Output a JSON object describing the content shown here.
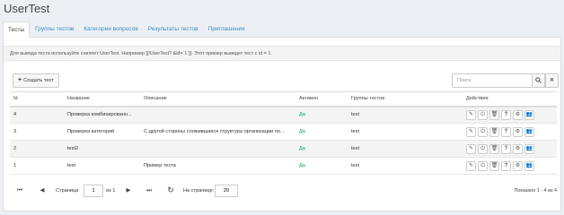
{
  "app": {
    "title": "UserTest"
  },
  "tabs": [
    {
      "label": "Тесты"
    },
    {
      "label": "Группы тестов"
    },
    {
      "label": "Категории вопросов"
    },
    {
      "label": "Результаты тестов"
    },
    {
      "label": "Приглашения"
    }
  ],
  "hint": "Для вывода теста используйте сниппет UserTest. Например [[!UserTest? &id=`1`]]. Этот пример выведет тест с id = 1.",
  "toolbar": {
    "create_label": "Создать тест",
    "create_icon": "plus-icon",
    "search_placeholder": "Поиск"
  },
  "table": {
    "headers": {
      "id": "Id",
      "name": "Название",
      "description": "Описание",
      "active": "Активно",
      "groups": "Группы тестов",
      "actions": "Действия"
    },
    "rows": [
      {
        "id": "4",
        "name": "Проверка комбинированн...",
        "description": "",
        "active": "Да",
        "groups": "test"
      },
      {
        "id": "3",
        "name": "Проверка категорий",
        "description": "С другой стороны сложившаяся структура организации по...",
        "active": "Да",
        "groups": "test"
      },
      {
        "id": "2",
        "name": "test2",
        "description": "",
        "active": "Да",
        "groups": "test"
      },
      {
        "id": "1",
        "name": "test",
        "description": "Пример теста",
        "active": "Да",
        "groups": "test"
      }
    ],
    "action_icons": [
      "edit-icon",
      "power-icon",
      "trash-icon",
      "question-icon",
      "settings-icon",
      "users-icon"
    ]
  },
  "pager": {
    "page_label": "Страница",
    "page_value": "1",
    "of_label": "из 1",
    "per_page_label": "На странице:",
    "per_page_value": "20",
    "summary": "Показано 1 - 4 из 4"
  },
  "colors": {
    "link": "#3c8dbc",
    "active_green": "#00a65a",
    "background": "#ecf0f5"
  }
}
